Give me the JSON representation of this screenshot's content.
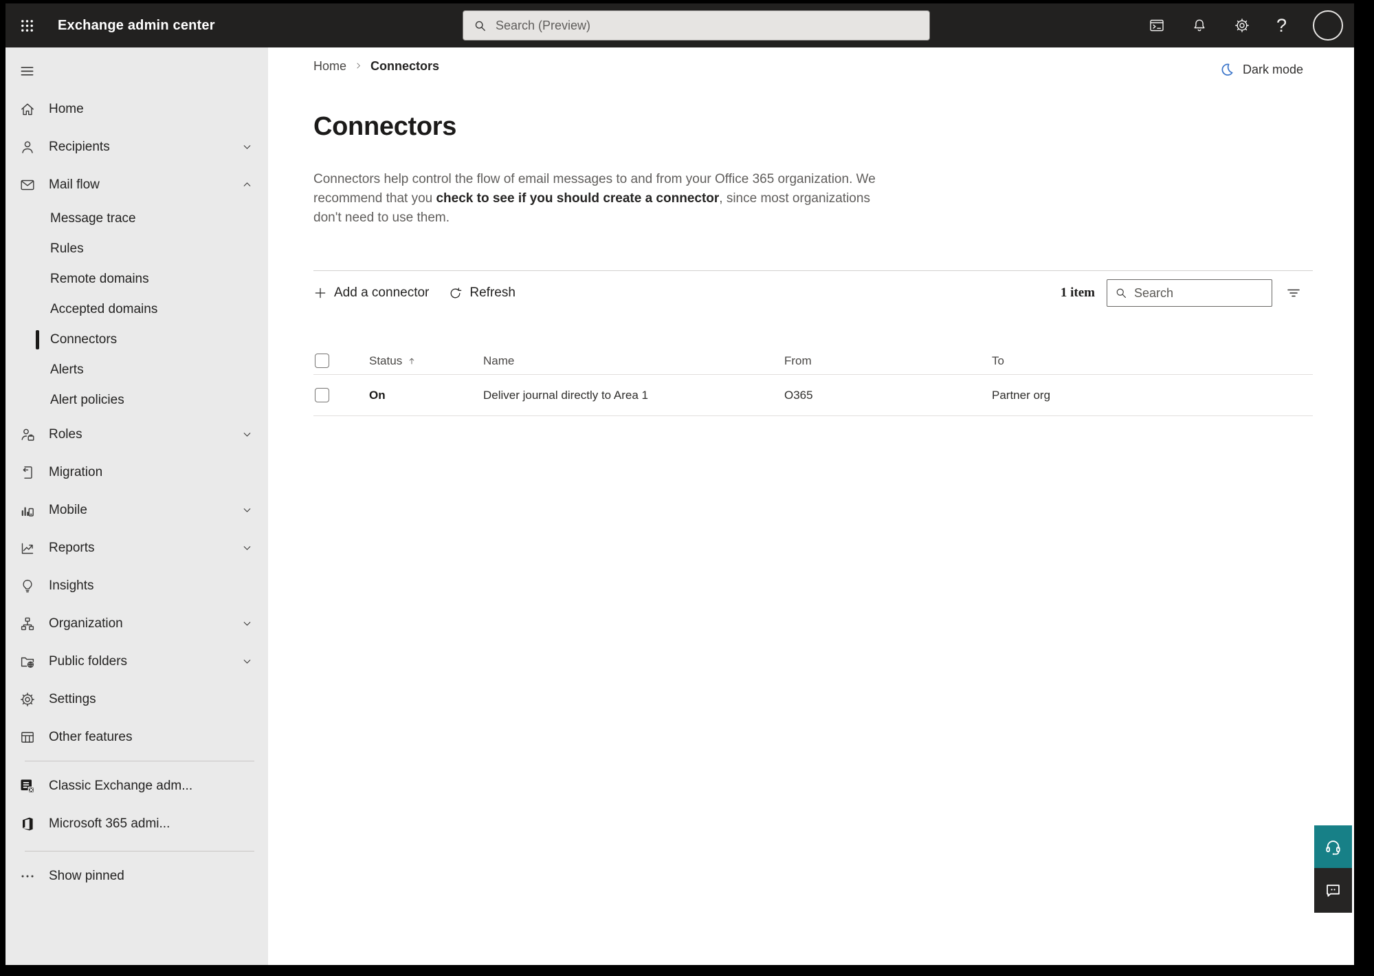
{
  "topbar": {
    "app_title": "Exchange admin center",
    "search_placeholder": "Search (Preview)",
    "icons": [
      "app-launcher",
      "powershell-console",
      "notifications-bell",
      "settings-gear",
      "help",
      "account-avatar"
    ],
    "help_glyph": "?"
  },
  "sidebar": {
    "items": [
      {
        "label": "Home",
        "icon": "home",
        "chevron": "none"
      },
      {
        "label": "Recipients",
        "icon": "person",
        "chevron": "down"
      },
      {
        "label": "Mail flow",
        "icon": "mail",
        "chevron": "up",
        "expanded": true
      },
      {
        "label": "Message trace",
        "icon": "none",
        "sub": true
      },
      {
        "label": "Rules",
        "icon": "none",
        "sub": true
      },
      {
        "label": "Remote domains",
        "icon": "none",
        "sub": true
      },
      {
        "label": "Accepted domains",
        "icon": "none",
        "sub": true
      },
      {
        "label": "Connectors",
        "icon": "none",
        "sub": true,
        "selected": true
      },
      {
        "label": "Alerts",
        "icon": "none",
        "sub": true
      },
      {
        "label": "Alert policies",
        "icon": "none",
        "sub": true
      },
      {
        "label": "Roles",
        "icon": "person-badge",
        "chevron": "down"
      },
      {
        "label": "Migration",
        "icon": "document-arrow",
        "chevron": "none"
      },
      {
        "label": "Mobile",
        "icon": "device-bars",
        "chevron": "down"
      },
      {
        "label": "Reports",
        "icon": "chart-trend",
        "chevron": "down"
      },
      {
        "label": "Insights",
        "icon": "lightbulb",
        "chevron": "none"
      },
      {
        "label": "Organization",
        "icon": "org-chart",
        "chevron": "down"
      },
      {
        "label": "Public folders",
        "icon": "folder-globe",
        "chevron": "down"
      },
      {
        "label": "Settings",
        "icon": "gear",
        "chevron": "none"
      },
      {
        "label": "Other features",
        "icon": "table-grid",
        "chevron": "none"
      },
      {
        "label": "Classic Exchange adm...",
        "icon": "exchange-logo",
        "chevron": "none"
      },
      {
        "label": "Microsoft 365 admi...",
        "icon": "microsoft-365-logo",
        "chevron": "none"
      },
      {
        "label": "Show pinned",
        "icon": "ellipsis",
        "chevron": "none"
      }
    ]
  },
  "main": {
    "breadcrumb": [
      "Home",
      "Connectors"
    ],
    "dark_mode_label": "Dark mode",
    "title": "Connectors",
    "description": {
      "part1": "Connectors help control the flow of email messages to and from your Office 365 organization. We recommend that you ",
      "link": "check to see if you should create a connector",
      "part2": ", since most organizations don't need to use them."
    },
    "toolbar": {
      "add_label": "Add a connector",
      "refresh_label": "Refresh",
      "item_count": "1 item",
      "search_placeholder": "Search"
    },
    "table": {
      "columns": [
        "Status",
        "Name",
        "From",
        "To"
      ],
      "rows": [
        {
          "status": "On",
          "name": "Deliver journal directly to Area 1",
          "from": "O365",
          "to": "Partner org"
        }
      ]
    }
  },
  "floating": {
    "support_icon": "headset",
    "feedback_icon": "chat-bubble"
  },
  "colors": {
    "topbar_bg": "#222120",
    "sidebar_bg": "#eaeaea",
    "accent_teal": "#178087",
    "moon_blue": "#3873c9",
    "selected_indicator": "#1b1a19"
  }
}
